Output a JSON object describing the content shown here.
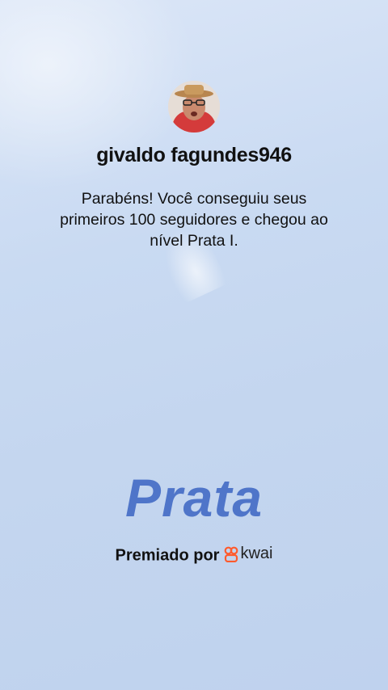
{
  "profile": {
    "username": "givaldo fagundes946"
  },
  "message": {
    "text": "Parabéns! Você conseguiu seus primeiros 100 seguidores e chegou ao nível Prata I."
  },
  "level": {
    "name": "Prata"
  },
  "awarded": {
    "label": "Premiado por",
    "brand": "kwai",
    "brand_icon": "kwai-logo-icon",
    "brand_color": "#ff5b2e"
  },
  "colors": {
    "level_text": "#4f75c9",
    "background": "#c9daf2"
  }
}
